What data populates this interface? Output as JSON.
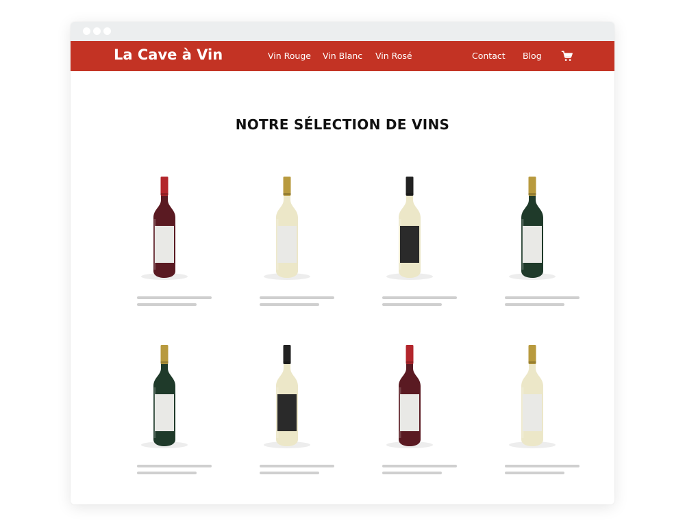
{
  "window": {
    "title_dots": [
      "dot-1",
      "dot-2",
      "dot-3"
    ]
  },
  "navbar": {
    "brand": "La Cave à Vin",
    "links": [
      "Vin Rouge",
      "Vin Blanc",
      "Vin Rosé",
      "Contact",
      "Blog"
    ],
    "cart_icon": "shopping-cart-icon",
    "background_color": "#c33324"
  },
  "main": {
    "title": "NOTRE SÉLECTION DE VINS"
  },
  "products": [
    {
      "kind": "red",
      "capsule": "red",
      "label": "white"
    },
    {
      "kind": "white",
      "capsule": "gold",
      "label": "white"
    },
    {
      "kind": "white",
      "capsule": "black",
      "label": "black"
    },
    {
      "kind": "green",
      "capsule": "gold",
      "label": "white"
    },
    {
      "kind": "green",
      "capsule": "gold",
      "label": "white"
    },
    {
      "kind": "white",
      "capsule": "black",
      "label": "black"
    },
    {
      "kind": "red",
      "capsule": "red",
      "label": "white"
    },
    {
      "kind": "white",
      "capsule": "gold",
      "label": "white"
    }
  ],
  "colors": {
    "bottle_red": "#5a1a22",
    "bottle_white": "#ece7c8",
    "bottle_green": "#1f3a2a",
    "capsule_red": "#b3262c",
    "capsule_gold": "#b89a3e",
    "capsule_black": "#222222",
    "label_white": "#e9e9e6",
    "label_black": "#2a2a2a"
  }
}
